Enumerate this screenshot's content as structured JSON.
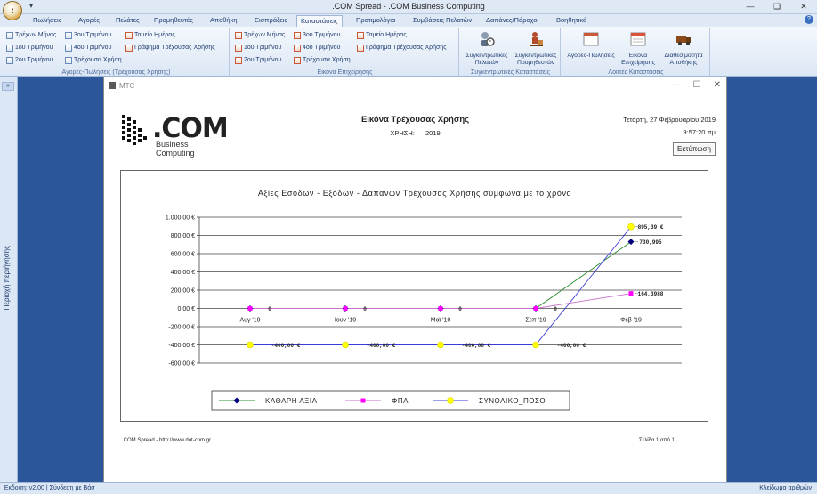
{
  "window": {
    "title": ".COM Spread - .COM Business Computing",
    "qat": "▾",
    "minimize": "—",
    "restore": "❏",
    "close": "✕"
  },
  "menu": {
    "tabs": [
      "Πωλήσεις",
      "Αγορές",
      "Πελάτες",
      "Προμηθευτές",
      "Αποθήκη",
      "Εισπράξεις",
      "Καταστάσεις",
      "Προτιμολόγια",
      "Συμβάσεις Πελατών",
      "Δαπάνες/Πάροχοι",
      "Βοηθητικά"
    ],
    "active": "Καταστάσεις",
    "help": "?"
  },
  "ribbon": {
    "group1": {
      "label": "Αγορές-Πωλήσεις (Τρέχουσας Χρήσης)",
      "items": [
        "Τρέχων Μήνας",
        "3ου Τριμήνου",
        "Ταμείο Ημέρας",
        "1ου Τριμήνου",
        "4ου Τριμήνου",
        "Γράφημα Τρέχουσας Χρήσης",
        "2ου Τριμήνου",
        "Τρέχουσα Χρήση"
      ]
    },
    "group2": {
      "label": "Εικόνα Επιχείρησης",
      "items": [
        "Τρέχων Μήνας",
        "3ου Τριμήνου",
        "Ταμείο Ημέρας",
        "1ου Τριμήνου",
        "4ου Τριμήνου",
        "Γράφημα Τρέχουσας Χρήσης",
        "2ου Τριμήνου",
        "Τρέχουσα Χρήση"
      ]
    },
    "group3": {
      "label": "Συγκεντρωτικές Καταστάσεις",
      "btn1": "Συγκεντρωτικές Πελατών",
      "btn2": "Συγκεντρωτικές Προμηθευτών"
    },
    "group4": {
      "label": "Λοιπές Καταστάσεις",
      "btn1": "Αγορές-Πωλήσεις",
      "btn2": "Εικόνα Επιχείρησης",
      "btn3": "Διαθεσιμότητα Αποθήκης"
    }
  },
  "leftrail": {
    "toggle": "»",
    "label": "Περιοχή περιήγησης"
  },
  "status": {
    "left": "Έκδοση: v2.00 | Σύνδεση με Βάσ",
    "right": "Κλείδωμα αριθμών"
  },
  "report": {
    "window_title": "MTC",
    "ctrl_min": "—",
    "ctrl_max": "☐",
    "ctrl_close": "✕",
    "logo_com": ".COM",
    "logo_sub": "Business Computing",
    "heading": "Εικόνα Τρέχουσας Χρήσης",
    "year_label": "ΧΡΗΣΗ:",
    "year_value": "2019",
    "date": "Τετάρτη, 27 Φεβρουαρίου 2019",
    "time": "9:57:20 πμ",
    "print_button": "Εκτύπωση",
    "footer_left": ".COM Spread - http://www.dot-com.gr",
    "footer_right": "Σελίδα 1 από 1"
  },
  "chart_data": {
    "type": "line",
    "title": "Αξίες Εσόδων - Εξόδων - Δαπανών Τρέχουσας Χρήσης σύμφωνα με το χρόνο",
    "categories": [
      "Αυγ '19",
      "Ιουν '19",
      "Μαϊ '19",
      "Σεπ '19",
      "Φεβ '19"
    ],
    "ylim": [
      -600,
      1000
    ],
    "yticks": [
      1000,
      800,
      600,
      400,
      200,
      0,
      -200,
      -400,
      -600
    ],
    "ytick_labels": [
      "1.000,00 €",
      "800,00 €",
      "600,00 €",
      "400,00 €",
      "200,00 €",
      "0,00 €",
      "-200,00 €",
      "-400,00 €",
      "-600,00 €"
    ],
    "grid": true,
    "legend_position": "bottom",
    "series": [
      {
        "name": "ΚΑΘΑΡΗ ΑΞΙΑ",
        "color": "#00007f",
        "line_color": "#2e8b2e",
        "marker": "diamond",
        "values": [
          0,
          0,
          0,
          0,
          730.995
        ],
        "labels": [
          "0",
          "0",
          "0",
          "0",
          "730,995"
        ]
      },
      {
        "name": "ΦΠΑ",
        "color": "#ff00ff",
        "line_color": "#c870c8",
        "marker": "square",
        "values": [
          0,
          0,
          0,
          0,
          164.3988
        ],
        "labels": [
          "",
          "",
          "",
          "",
          "164,3988"
        ]
      },
      {
        "name": "ΣΥΝΟΛΙΚΟ_ΠΟΣΟ",
        "color": "#ffff00",
        "line_color": "#3a3ad8",
        "marker": "circle",
        "values": [
          -400,
          -400,
          -400,
          -400,
          895.39
        ],
        "labels": [
          "-400,00 €",
          "-400,00 €",
          "-400,00 €",
          "-400,00 €",
          "895,39 €"
        ]
      }
    ]
  }
}
